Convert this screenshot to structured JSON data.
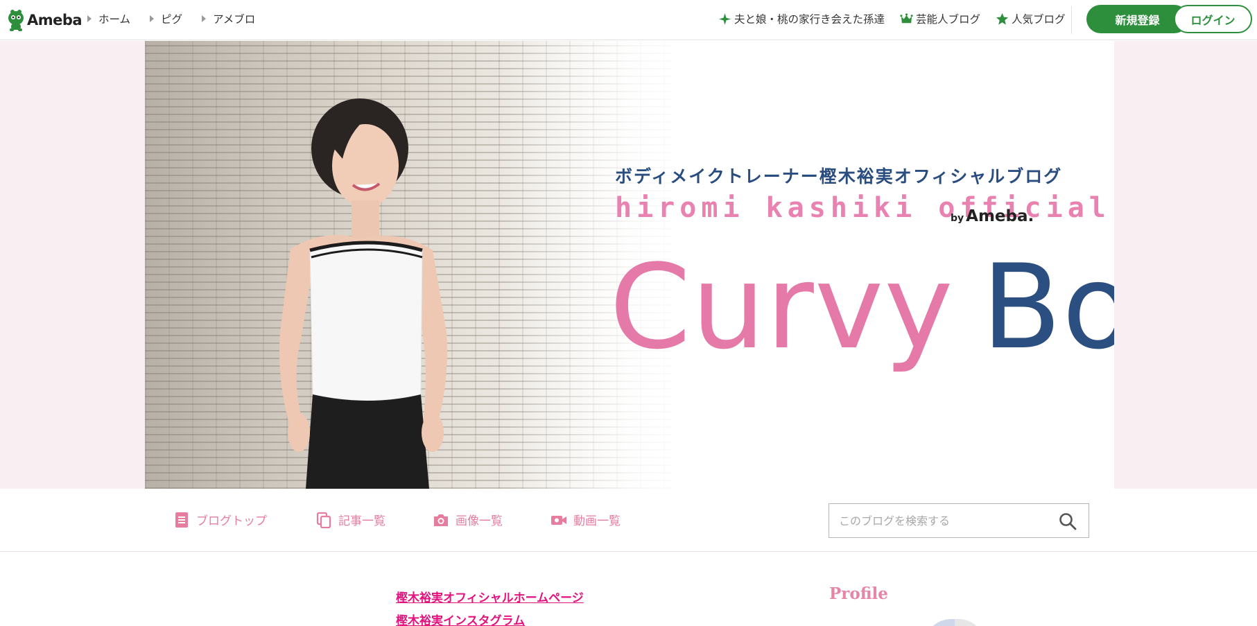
{
  "header": {
    "logo_text": "Ameba",
    "nav": [
      {
        "label": "ホーム"
      },
      {
        "label": "ピグ"
      },
      {
        "label": "アメブロ"
      }
    ],
    "right_links": [
      {
        "label": "夫と娘・桃の家行き会えた孫達",
        "icon": "sparkle-icon"
      },
      {
        "label": "芸能人ブログ",
        "icon": "crown-icon"
      },
      {
        "label": "人気ブログ",
        "icon": "star-icon"
      }
    ],
    "register_label": "新規登録",
    "login_label": "ログイン",
    "accent_color": "#2d8f3c"
  },
  "hero": {
    "subtitle_jp": "ボディメイクトレーナー樫木裕実オフィシャルブログ",
    "subtitle_en": "hiromi kashiki official blog",
    "by_prefix": "by",
    "by_brand": "Ameba.",
    "title_part1": "Curvy",
    "title_part2": "Body",
    "title_color_1": "#e57aa8",
    "title_color_2": "#2c4f82"
  },
  "subnav": {
    "items": [
      {
        "label": "ブログトップ",
        "icon": "document-icon"
      },
      {
        "label": "記事一覧",
        "icon": "copy-icon"
      },
      {
        "label": "画像一覧",
        "icon": "camera-icon"
      },
      {
        "label": "動画一覧",
        "icon": "video-icon"
      }
    ],
    "search_placeholder": "このブログを検索する",
    "accent_color": "#e67c9e"
  },
  "main": {
    "links": [
      {
        "label": "樫木裕実オフィシャルホームページ"
      },
      {
        "label": "樫木裕実インスタグラム"
      }
    ],
    "link_color": "#e3127f"
  },
  "sidebar": {
    "profile_heading": "Profile"
  }
}
